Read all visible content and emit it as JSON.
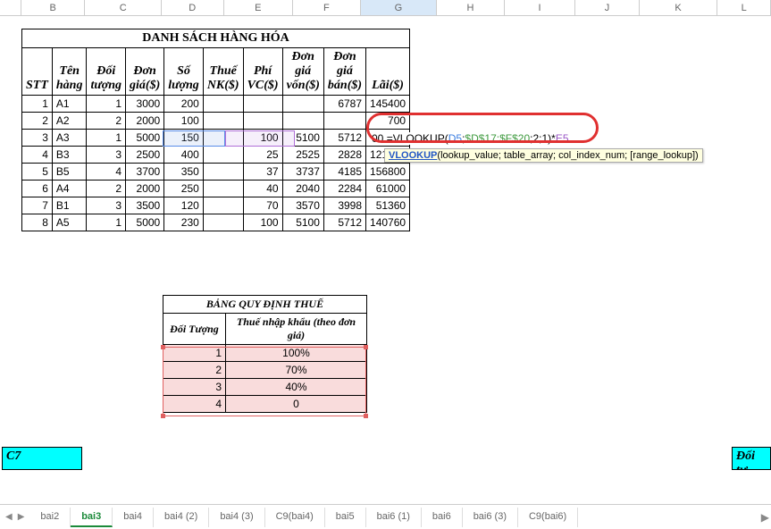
{
  "columns": [
    "B",
    "C",
    "D",
    "E",
    "F",
    "G",
    "H",
    "I",
    "J",
    "K",
    "L"
  ],
  "active_col": "G",
  "title": "DANH SÁCH HÀNG HÓA",
  "headers": {
    "stt": "STT",
    "ten": "Tên hàng",
    "doituong": "Đối tượng",
    "dongia": "Đơn giá($)",
    "soluong": "Số lượng",
    "thuenk": "Thuế NK($)",
    "phivc": "Phí VC($)",
    "giavon": "Đơn giá vốn($)",
    "giaban": "Đơn giá bán($)",
    "lai": "Lãi($)"
  },
  "rows": [
    {
      "stt": "1",
      "ten": "A1",
      "dt": "1",
      "dg": "3000",
      "sl": "200",
      "thuenk": "",
      "phivc": "",
      "vonn": "",
      "ban": "6787",
      "lai": "145400"
    },
    {
      "stt": "2",
      "ten": "A2",
      "dt": "2",
      "dg": "2000",
      "sl": "100",
      "thuenk": "",
      "phivc": "",
      "vonn": "",
      "ban": "",
      "lai": "700"
    },
    {
      "stt": "3",
      "ten": "A3",
      "dt": "1",
      "dg": "5000",
      "sl": "150",
      "thuenk": "",
      "phivc": "100",
      "vonn": "5100",
      "ban": "5712",
      "lai": "91800"
    },
    {
      "stt": "4",
      "ten": "B3",
      "dt": "3",
      "dg": "2500",
      "sl": "400",
      "thuenk": "",
      "phivc": "25",
      "vonn": "2525",
      "ban": "2828",
      "lai": "121200"
    },
    {
      "stt": "5",
      "ten": "B5",
      "dt": "4",
      "dg": "3700",
      "sl": "350",
      "thuenk": "",
      "phivc": "37",
      "vonn": "3737",
      "ban": "4185",
      "lai": "156800"
    },
    {
      "stt": "6",
      "ten": "A4",
      "dt": "2",
      "dg": "2000",
      "sl": "250",
      "thuenk": "",
      "phivc": "40",
      "vonn": "2040",
      "ban": "2284",
      "lai": "61000"
    },
    {
      "stt": "7",
      "ten": "B1",
      "dt": "3",
      "dg": "3500",
      "sl": "120",
      "thuenk": "",
      "phivc": "70",
      "vonn": "3570",
      "ban": "3998",
      "lai": "51360"
    },
    {
      "stt": "8",
      "ten": "A5",
      "dt": "1",
      "dg": "5000",
      "sl": "230",
      "thuenk": "",
      "phivc": "100",
      "vonn": "5100",
      "ban": "5712",
      "lai": "140760"
    }
  ],
  "formula": {
    "prefix_sl_tail": "00",
    "eq": "=VLOOKUP(",
    "a1": "D5",
    "sep1": ";",
    "a2": "$D$17:$F$20",
    "sep2": ";2;1)*",
    "a3": "E5"
  },
  "tooltip": {
    "fn": "VLOOKUP",
    "rest": "(lookup_value; table_array; col_index_num; [range_lookup])"
  },
  "lookup": {
    "title": "BẢNG QUY ĐỊNH THUẾ",
    "h1": "Đối Tượng",
    "h2": "Thuế nhập khẩu (theo đơn giá)",
    "rows": [
      {
        "dt": "1",
        "val": "100%"
      },
      {
        "dt": "2",
        "val": "70%"
      },
      {
        "dt": "3",
        "val": "40%"
      },
      {
        "dt": "4",
        "val": "0"
      }
    ]
  },
  "cyan_left": "C7",
  "cyan_right": "Đối tư",
  "tabs": [
    "bai2",
    "bai3",
    "bai4",
    "bai4 (2)",
    "bai4 (3)",
    "C9(bai4)",
    "bai5",
    "bai6 (1)",
    "bai6",
    "bai6 (3)",
    "C9(bai6)"
  ],
  "active_tab": "bai3"
}
